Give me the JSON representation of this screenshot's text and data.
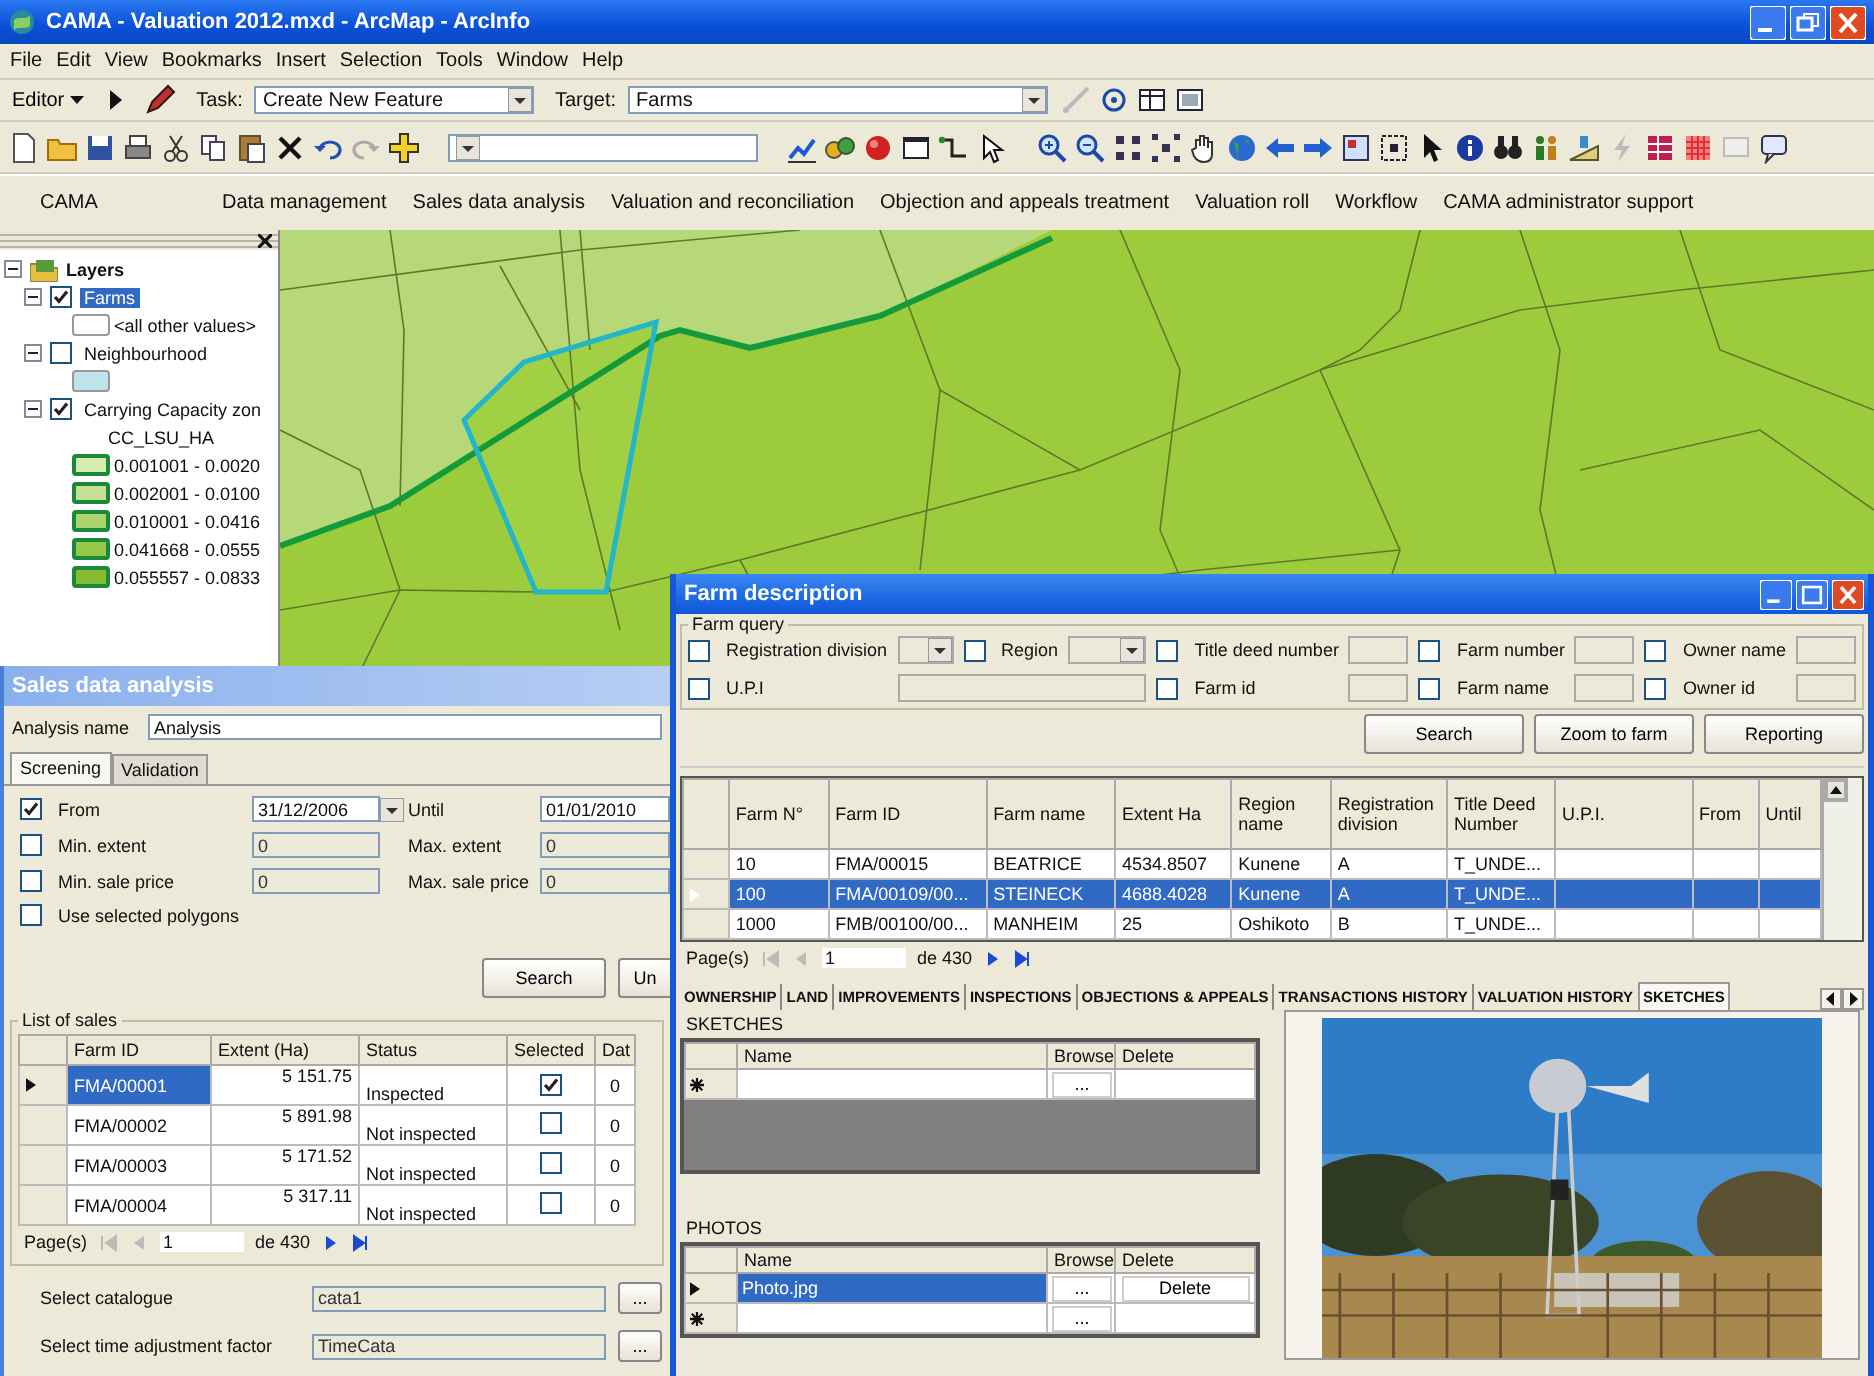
{
  "window": {
    "title": "CAMA - Valuation 2012.mxd - ArcMap - ArcInfo"
  },
  "menu_bar": [
    "File",
    "Edit",
    "View",
    "Bookmarks",
    "Insert",
    "Selection",
    "Tools",
    "Window",
    "Help"
  ],
  "editor_toolbar": {
    "editor": "Editor",
    "task_label": "Task:",
    "task": "Create New Feature",
    "target_label": "Target:",
    "target": "Farms"
  },
  "cama_toolbar": {
    "title": "CAMA",
    "items": [
      "Data management",
      "Sales data analysis",
      "Valuation and reconciliation",
      "Objection and appeals treatment",
      "Valuation roll",
      "Workflow",
      "CAMA administrator support"
    ]
  },
  "toc": {
    "title": "Layers",
    "expanded": true,
    "layers": [
      {
        "name": "Farms",
        "checked": true,
        "selected": true,
        "expanded": true,
        "legend": [
          {
            "label": "<all other values>",
            "color": "#ffffff"
          }
        ]
      },
      {
        "name": "Neighbourhood",
        "checked": false,
        "selected": false,
        "expanded": true,
        "legend": [
          {
            "color": "#bfe2ec"
          }
        ]
      },
      {
        "name": "Carrying Capacity zon",
        "checked": true,
        "selected": false,
        "expanded": true,
        "field": "CC_LSU_HA",
        "legend": [
          {
            "label": "0.001001 - 0.0020",
            "color": "#d9ecb0"
          },
          {
            "label": "0.002001 - 0.0100",
            "color": "#c4e090"
          },
          {
            "label": "0.010001 - 0.0416",
            "color": "#acd46c"
          },
          {
            "label": "0.041668 - 0.0555",
            "color": "#98c84a"
          },
          {
            "label": "0.055557 - 0.0833",
            "color": "#84bc34"
          }
        ]
      }
    ]
  },
  "sales_window": {
    "title": "Sales data analysis",
    "analysis_label": "Analysis name",
    "analysis": "Analysis",
    "tabs": [
      {
        "label": "Screening",
        "selected": true
      },
      {
        "label": "Validation",
        "selected": false
      }
    ],
    "criteria": [
      {
        "kind": "date",
        "label": "From",
        "checked": true,
        "value": "31/12/2006",
        "second_label": "Until",
        "second_value": "01/01/2010"
      },
      {
        "kind": "range",
        "label": "Min. extent",
        "checked": false,
        "value": "0",
        "second_label": "Max. extent",
        "second_value": "0"
      },
      {
        "kind": "range",
        "label": "Min. sale price",
        "checked": false,
        "value": "0",
        "second_label": "Max. sale price",
        "second_value": "0"
      },
      {
        "kind": "flag",
        "label": "Use selected polygons",
        "checked": false
      }
    ],
    "buttons": [
      "Search",
      "Un"
    ],
    "list": {
      "title": "List of sales",
      "columns": [
        "Farm ID",
        "Extent (Ha)",
        "Status",
        "Selected",
        "Dat"
      ],
      "rows": [
        {
          "farm_id": "FMA/00001",
          "extent": "5 151.75",
          "status": "Inspected",
          "checked": true,
          "date": "0",
          "selected": true
        },
        {
          "farm_id": "FMA/00002",
          "extent": "5 891.98",
          "status": "Not inspected",
          "checked": false,
          "date": "0",
          "selected": false
        },
        {
          "farm_id": "FMA/00003",
          "extent": "5 171.52",
          "status": "Not inspected",
          "checked": false,
          "date": "0",
          "selected": false
        },
        {
          "farm_id": "FMA/00004",
          "extent": "5 317.11",
          "status": "Not inspected",
          "checked": false,
          "date": "0",
          "selected": false
        }
      ]
    },
    "pager": {
      "label": "Page(s)",
      "page": "1",
      "total": "de 430"
    },
    "settings": [
      {
        "label": "Select catalogue",
        "value": "cata1",
        "browse": "..."
      },
      {
        "label": "Select time adjustment factor",
        "value": "TimeCata",
        "browse": "..."
      }
    ]
  },
  "farm_window": {
    "title": "Farm description",
    "query_title": "Farm query",
    "query_rows": [
      [
        {
          "label": "Registration division",
          "checked": false,
          "kind": "combo"
        },
        {
          "label": "Region",
          "checked": false,
          "kind": "combo_wide"
        },
        {
          "label": "Title deed number",
          "checked": false,
          "kind": "text"
        },
        {
          "label": "Farm number",
          "checked": false,
          "kind": "text"
        },
        {
          "label": "Owner name",
          "checked": false,
          "kind": "text"
        }
      ],
      [
        {
          "label": "U.P.I",
          "checked": false,
          "kind": "text_wide"
        },
        {
          "label": "Farm id",
          "checked": false,
          "kind": "text"
        },
        {
          "label": "Farm name",
          "checked": false,
          "kind": "text"
        },
        {
          "label": "Owner id",
          "checked": false,
          "kind": "text"
        }
      ]
    ],
    "buttons": [
      "Search",
      "Zoom to farm",
      "Reporting"
    ],
    "grid": {
      "columns": [
        "Farm N°",
        "Farm ID",
        "Farm name",
        "Extent Ha",
        "Region name",
        "Registration division",
        "Title Deed Number",
        "U.P.I.",
        "From",
        "Until"
      ],
      "rows": [
        {
          "selected": false,
          "cells": [
            "10",
            "FMA/00015",
            "BEATRICE",
            "4534.8507",
            "Kunene",
            "A",
            "T_UNDE..."
          ]
        },
        {
          "selected": true,
          "cells": [
            "100",
            "FMA/00109/00...",
            "STEINECK",
            "4688.4028",
            "Kunene",
            "A",
            "T_UNDE..."
          ]
        },
        {
          "selected": false,
          "cells": [
            "1000",
            "FMB/00100/00...",
            "MANHEIM",
            "25",
            "Oshikoto",
            "B",
            "T_UNDE..."
          ]
        }
      ]
    },
    "pager": {
      "label": "Page(s)",
      "page": "1",
      "total": "de 430"
    },
    "tabs": [
      {
        "label": "OWNERSHIP",
        "selected": false
      },
      {
        "label": "LAND",
        "selected": false
      },
      {
        "label": "IMPROVEMENTS",
        "selected": false
      },
      {
        "label": "INSPECTIONS",
        "selected": false
      },
      {
        "label": "OBJECTIONS & APPEALS",
        "selected": false
      },
      {
        "label": "TRANSACTIONS HISTORY",
        "selected": false
      },
      {
        "label": "VALUATION HISTORY",
        "selected": false
      },
      {
        "label": "SKETCHES",
        "selected": true
      }
    ],
    "sketches": {
      "title": "SKETCHES",
      "columns": [
        "Name",
        "Browse",
        "Delete"
      ],
      "rows": [
        {
          "kind": "new",
          "browse": "..."
        }
      ]
    },
    "photos": {
      "title": "PHOTOS",
      "columns": [
        "Name",
        "Browse",
        "Delete"
      ],
      "rows": [
        {
          "kind": "item",
          "selected": true,
          "name": "Photo.jpg",
          "browse": "...",
          "delete": "Delete"
        },
        {
          "kind": "new",
          "browse": "..."
        }
      ]
    }
  }
}
